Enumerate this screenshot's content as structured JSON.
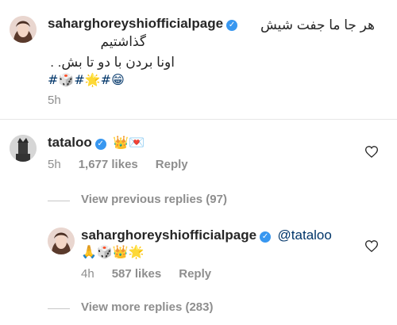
{
  "post": {
    "username": "saharghoreyshiofficialpage",
    "caption_line1": "هر جا ما جفت شیش",
    "caption_line2": "گذاشتیم",
    "caption_line3": "اونا بردن با دو تا بش. .",
    "hashtags": "#🎲#🌟#😁",
    "time": "5h"
  },
  "comment": {
    "username": "tataloo",
    "emojis": "👑💌",
    "time": "5h",
    "likes": "1,677 likes",
    "reply": "Reply"
  },
  "view_previous": "View previous replies (97)",
  "reply": {
    "username": "saharghoreyshiofficialpage",
    "mention": "@tataloo",
    "emojis": "🙏🎲👑🌟",
    "time": "4h",
    "likes": "587 likes",
    "reply": "Reply"
  },
  "view_more": "View more replies (283)",
  "icons": {
    "verified": "verified-badge-icon",
    "like": "heart-outline-icon"
  },
  "colors": {
    "verified": "#3897f0",
    "mention": "#003569",
    "secondary": "#8e8e8e"
  }
}
